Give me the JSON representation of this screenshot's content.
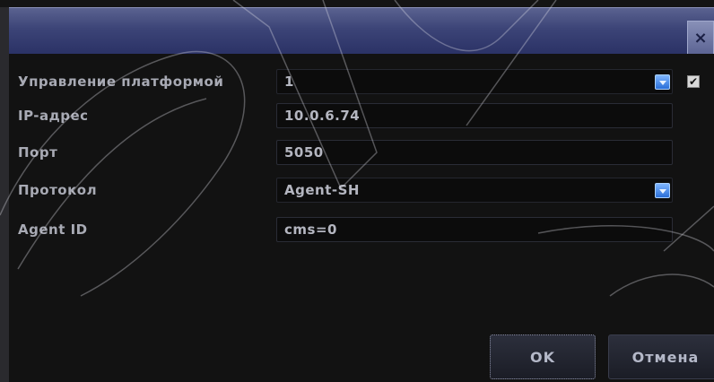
{
  "dialog": {
    "close_glyph": "×"
  },
  "fields": [
    {
      "label": "Управление платформой",
      "value": "1",
      "type": "select",
      "checked": true
    },
    {
      "label": "IP-адрес",
      "value": "10.0.6.74",
      "type": "text"
    },
    {
      "label": "Порт",
      "value": "5050",
      "type": "text"
    },
    {
      "label": "Протокол",
      "value": "Agent-SH",
      "type": "select"
    },
    {
      "label": "Agent ID",
      "value": "cms=0",
      "type": "text"
    }
  ],
  "buttons": {
    "ok_label": "OK",
    "cancel_label": "Отмена"
  },
  "colors": {
    "titlebar": "#3c4477",
    "dropdown_accent": "#2a6fd8",
    "text": "#a8aab4"
  }
}
